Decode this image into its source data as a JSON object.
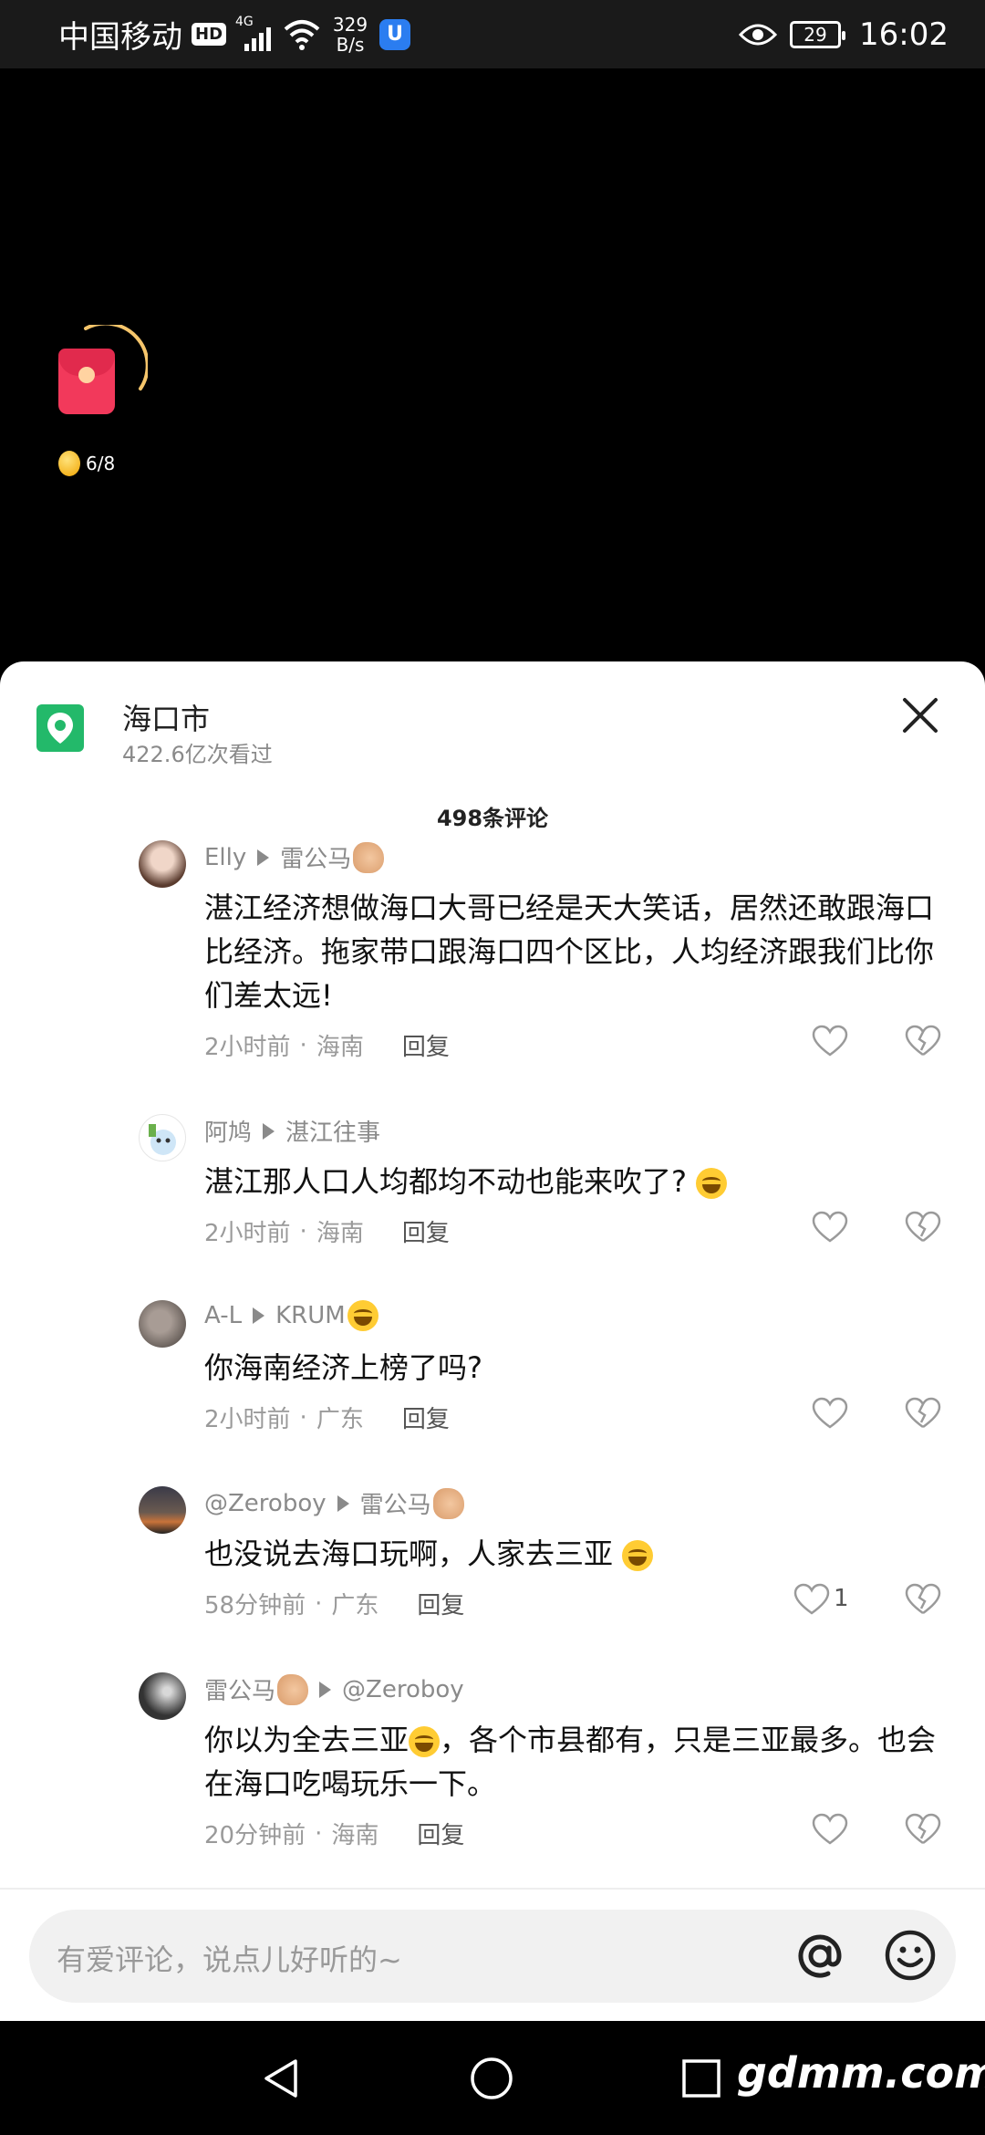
{
  "status_bar": {
    "carrier": "中国移动",
    "hd": "HD",
    "signal_label": "4G",
    "net_speed_value": "329",
    "net_speed_unit": "B/s",
    "battery": "29",
    "time": "16:02"
  },
  "float_widget": {
    "coin_progress": "6/8"
  },
  "location": {
    "title": "海口市",
    "views": "422.6亿次看过"
  },
  "comment_count": "498条评论",
  "comments": [
    {
      "user": "Elly",
      "reply_to": "雷公马",
      "reply_to_emoji": "horse-emoji",
      "text": "湛江经济想做海口大哥已经是天大笑话，居然还敢跟海口比经济。拖家带口跟海口四个区比，人均经济跟我们比你们差太远!",
      "time": "2小时前",
      "region": "海南",
      "reply_label": "回复",
      "likes": ""
    },
    {
      "user": "阿鸠",
      "reply_to": "湛江往事",
      "text": "湛江那人口人均都均不动也能来吹了?",
      "text_emoji": "laugh-sweat-emoji",
      "time": "2小时前",
      "region": "海南",
      "reply_label": "回复",
      "likes": ""
    },
    {
      "user": "A-L",
      "reply_to": "KRUM",
      "reply_to_emoji": "grin-emoji",
      "text": "你海南经济上榜了吗?",
      "time": "2小时前",
      "region": "广东",
      "reply_label": "回复",
      "likes": ""
    },
    {
      "user": "@Zeroboy",
      "reply_to": "雷公马",
      "reply_to_emoji": "horse-emoji",
      "text": "也没说去海口玩啊，人家去三亚",
      "text_emoji": "laugh-sweat-emoji",
      "time": "58分钟前",
      "region": "广东",
      "reply_label": "回复",
      "likes": "1"
    },
    {
      "user": "雷公马",
      "user_emoji": "horse-emoji",
      "reply_to": "@Zeroboy",
      "text_part1": "你以为全去三亚",
      "text_part2": "，各个市县都有，只是三亚最多。也会在海口吃喝玩乐一下。",
      "text_emoji": "laugh-sweat-emoji",
      "time": "20分钟前",
      "region": "海南",
      "reply_label": "回复",
      "likes": ""
    }
  ],
  "input": {
    "placeholder": "有爱评论，说点儿好听的~"
  },
  "meta_sep": "·",
  "watermark": "gdmm.com",
  "colors": {
    "sheet_bg": "#ffffff",
    "location_green": "#23b96a",
    "red_packet": "#f2395b",
    "muted_text": "#8a8a8a"
  }
}
